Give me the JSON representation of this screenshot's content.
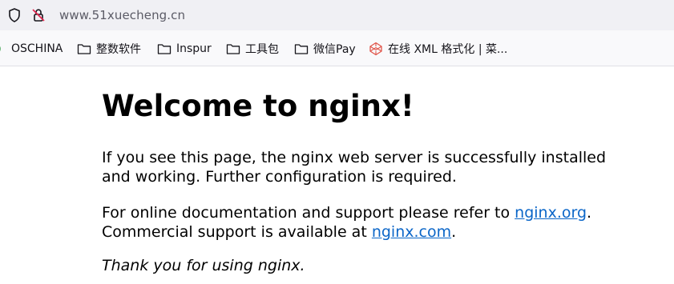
{
  "browser": {
    "url": "www.51xuecheng.cn"
  },
  "bookmarks": [
    {
      "label": "OSCHINA",
      "icon": "oschina-icon"
    },
    {
      "label": "整数软件",
      "icon": "folder-icon"
    },
    {
      "label": "Inspur",
      "icon": "folder-icon"
    },
    {
      "label": "工具包",
      "icon": "folder-icon"
    },
    {
      "label": "微信Pay",
      "icon": "folder-icon"
    },
    {
      "label": "在线 XML 格式化 | 菜...",
      "icon": "codepen-icon"
    }
  ],
  "page": {
    "title": "Welcome to nginx!",
    "para1": "If you see this page, the nginx web server is successfully installed and working. Further configuration is required.",
    "para2_prefix": "For online documentation and support please refer to ",
    "link1": "nginx.org",
    "para2_mid": ".",
    "para2_line2_prefix": "Commercial support is available at ",
    "link2": "nginx.com",
    "para2_suffix": ".",
    "thanks": "Thank you for using nginx."
  },
  "colors": {
    "link": "#0b66c8",
    "urlbar_bg": "#f0f0f4",
    "bookmarks_bg": "#f9f9fb"
  }
}
